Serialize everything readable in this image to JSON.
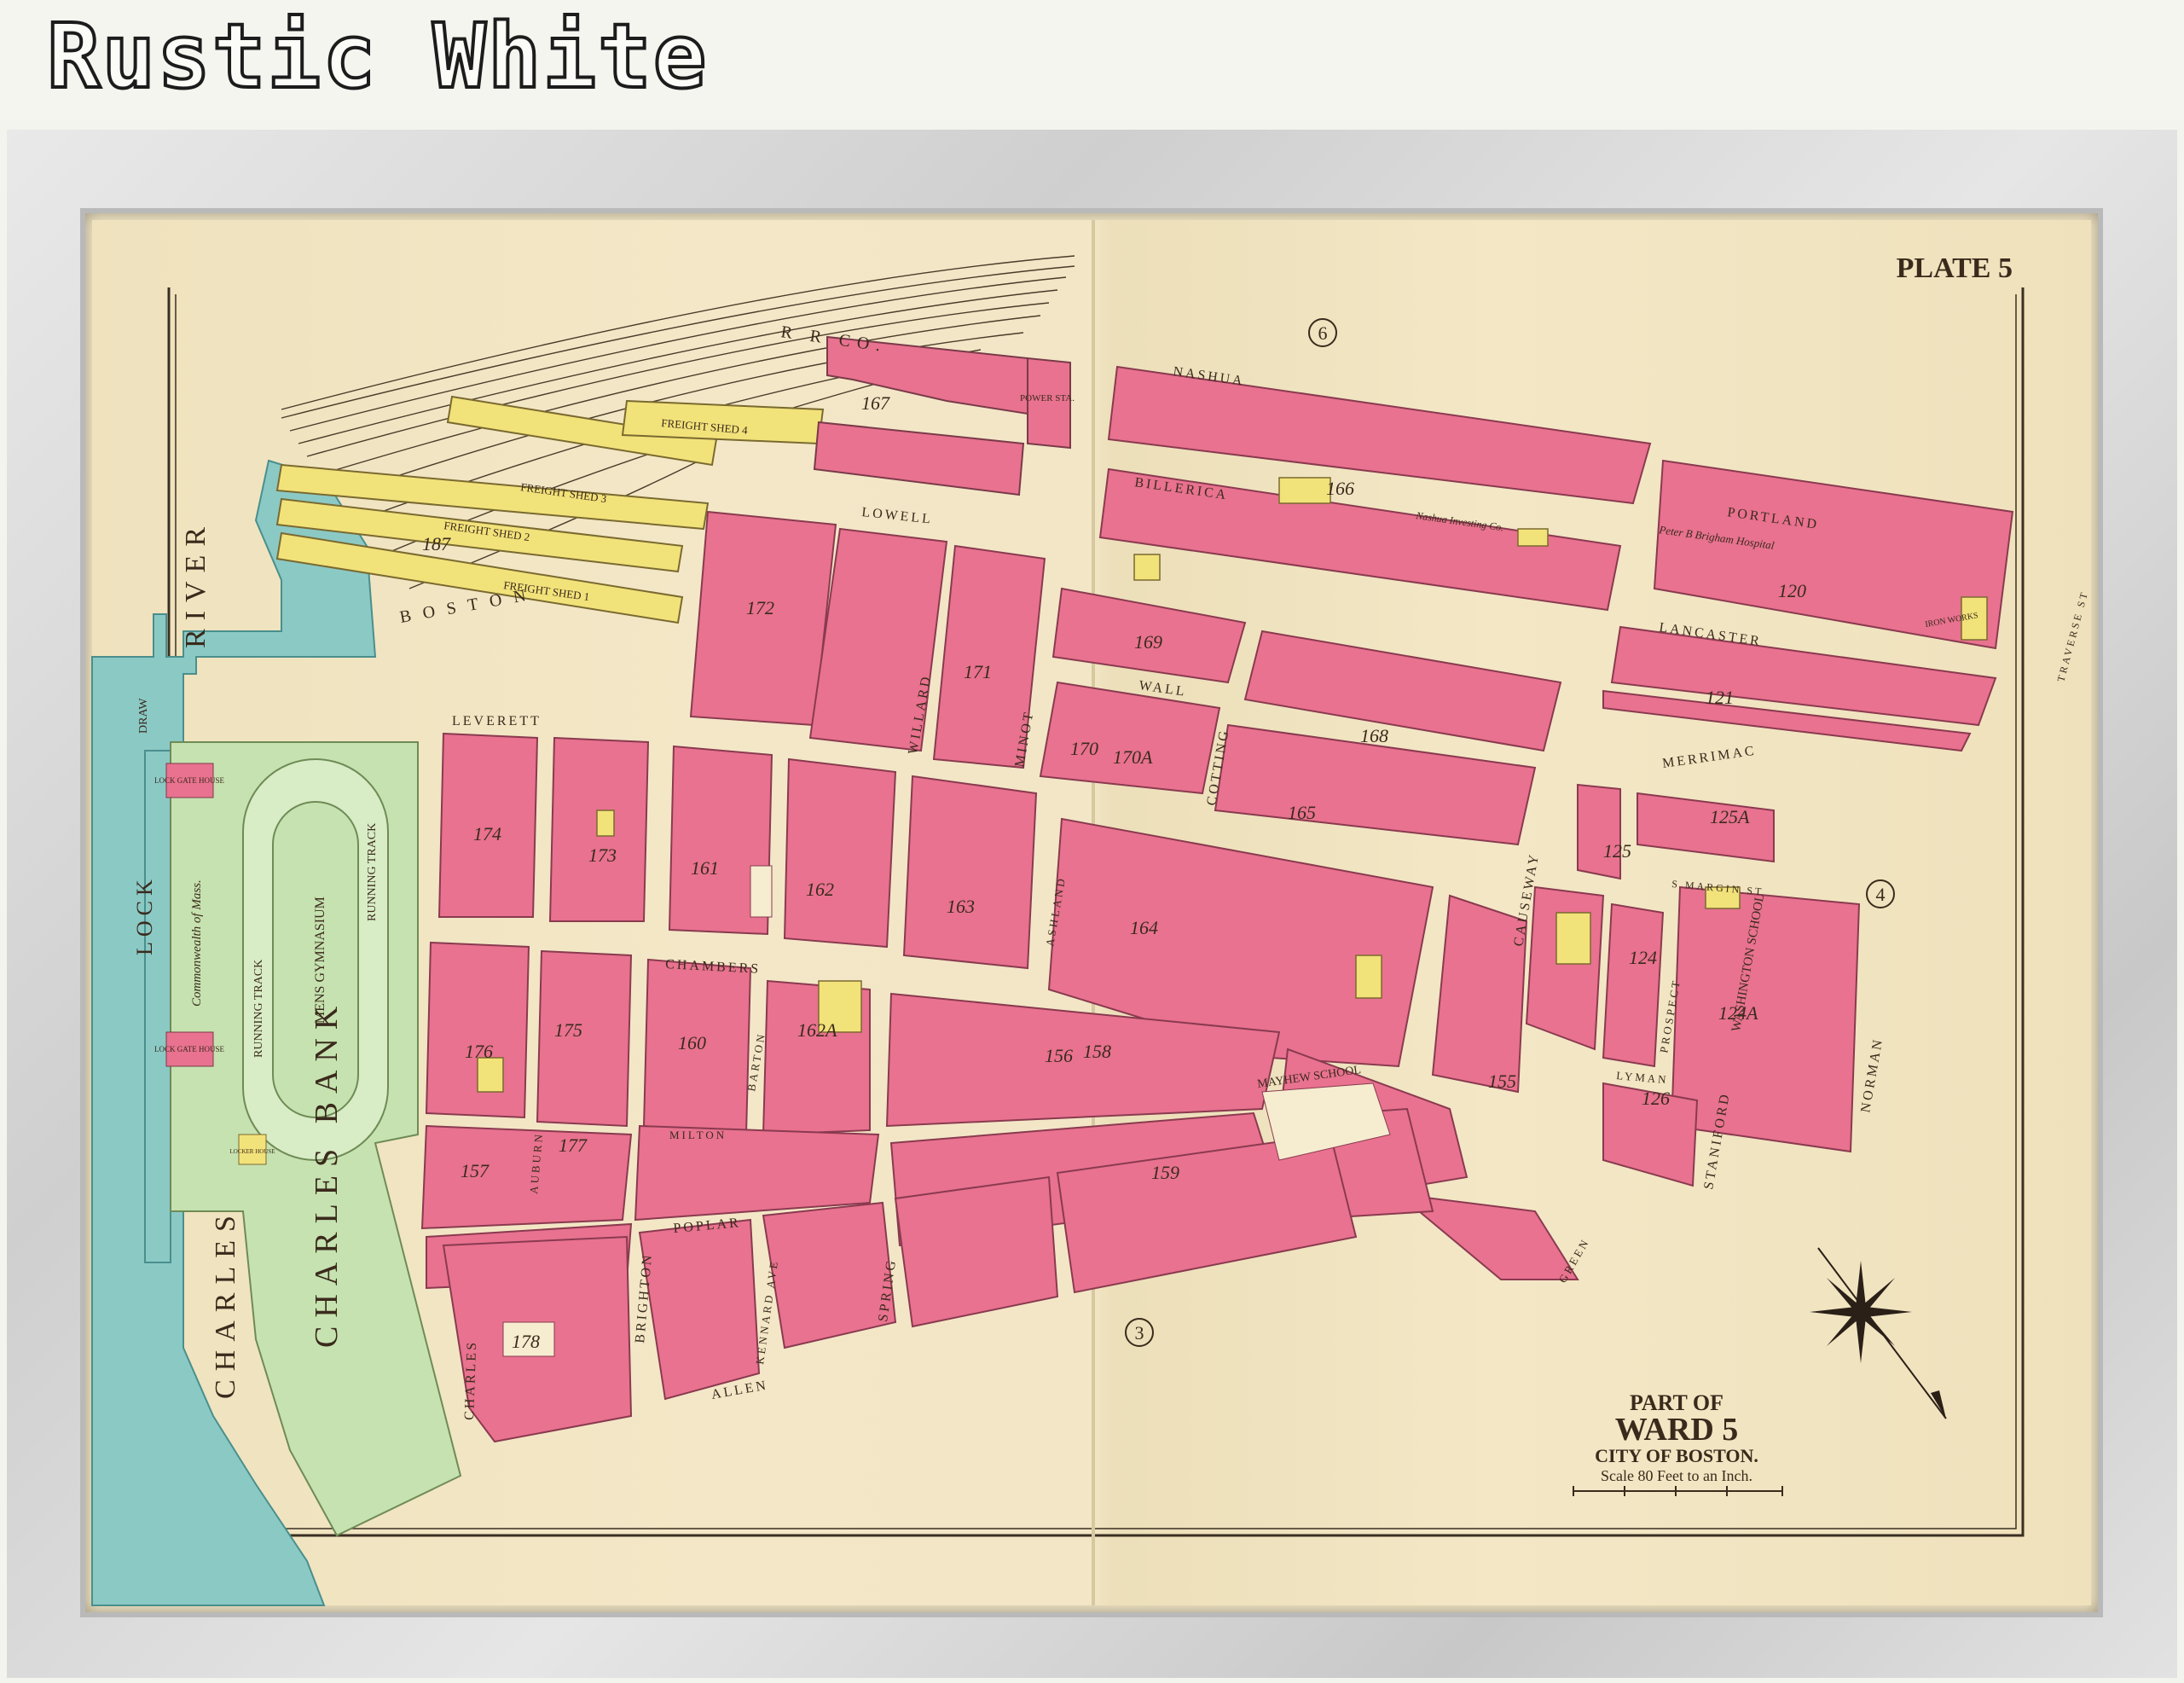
{
  "banner": {
    "title": "Rustic White"
  },
  "plate": {
    "label": "PLATE 5"
  },
  "title_block": {
    "line1": "PART OF",
    "line2": "WARD 5",
    "line3": "CITY OF BOSTON.",
    "scale": "Scale 80 Feet to an Inch."
  },
  "ward_markers": [
    "6",
    "4",
    "3"
  ],
  "water_labels": {
    "river": "RIVER",
    "charles": "CHARLES",
    "lock": "LOCK",
    "draw": "DRAW"
  },
  "park_labels": {
    "bank": "CHARLES BANK",
    "gym": "MENS GYMNASIUM",
    "track1": "RUNNING TRACK",
    "track2": "RUNNING TRACK",
    "lock_gate_1": "LOCK GATE HOUSE",
    "lock_gate_2": "LOCK GATE HOUSE",
    "locker": "LOCKER HOUSE",
    "commonwealth": "Commonwealth of Mass."
  },
  "rail_labels": {
    "rrco": "R R CO.",
    "power": "POWER STA.",
    "shed1": "FREIGHT SHED 1",
    "shed2": "FREIGHT SHED 2",
    "shed3": "FREIGHT SHED 3",
    "shed4": "FREIGHT SHED 4",
    "boston": "BOSTON"
  },
  "streets": {
    "nashua": "NASHUA",
    "billerica": "BILLERICA",
    "portland": "PORTLAND",
    "lancaster": "LANCASTER",
    "traverse": "TRAVERSE ST",
    "merrimac": "MERRIMAC",
    "margin": "S MARGIN ST",
    "lowell": "LOWELL",
    "leverett": "LEVERETT",
    "wall": "WALL",
    "minot": "MINOT",
    "willard": "WILLARD",
    "cotting": "COTTING",
    "causeway": "CAUSEWAY",
    "chambers": "CHAMBERS",
    "barton": "BARTON",
    "ashland": "ASHLAND",
    "lyman": "LYMAN",
    "prospect": "PROSPECT",
    "staniford": "STANIFORD",
    "norman": "NORMAN",
    "milton": "MILTON",
    "poplar": "POPLAR",
    "auburn": "AUBURN",
    "brighton": "BRIGHTON",
    "kennard": "KENNARD AVE",
    "spring": "SPRING",
    "allen": "ALLEN",
    "charles": "CHARLES",
    "green": "GREEN",
    "st": "ST."
  },
  "landmarks": {
    "mayhew": "MAYHEW SCHOOL",
    "washington": "WASHINGTON SCHOOL",
    "brigham": "Peter B Brigham Hospital",
    "iron": "IRON WORKS",
    "nashua_inv": "Nashua Investing Co."
  },
  "plate_numbers": [
    "167",
    "187",
    "172",
    "171",
    "166",
    "169",
    "168",
    "170",
    "170A",
    "165",
    "164",
    "163",
    "162",
    "162A",
    "161",
    "160",
    "159",
    "158",
    "157",
    "156",
    "155",
    "174",
    "173",
    "175",
    "176",
    "177",
    "178",
    "120",
    "121",
    "125",
    "124",
    "124A",
    "125A",
    "126"
  ],
  "colors": {
    "block_pink": "#e8728f",
    "yellow": "#f2e27a",
    "green": "#c7e3b2",
    "water": "#86c9c6",
    "street": "#f2e6c6"
  }
}
